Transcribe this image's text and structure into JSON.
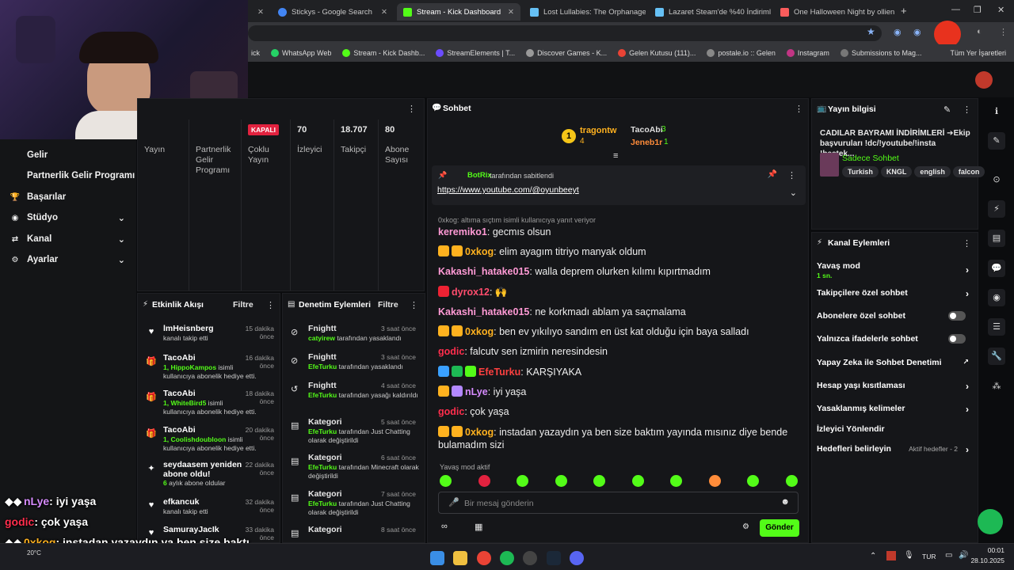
{
  "browser": {
    "tabs": [
      {
        "label": "Stickys - Google Search",
        "color": "#4285f4"
      },
      {
        "label": "Stream - Kick Dashboard",
        "color": "#53fc18"
      },
      {
        "label": "Lost Lullabies: The Orphanage",
        "color": "#66c0f4"
      },
      {
        "label": "Lazaret Steam'de %40 İndirimli",
        "color": "#66c0f4"
      },
      {
        "label": "One Halloween Night by ollien",
        "color": "#fa5c5c"
      }
    ],
    "bookmarks": [
      "WhatsApp Web",
      "Stream - Kick Dashb...",
      "StreamElements | T...",
      "Discover Games - K...",
      "Gelen Kutusu (111)...",
      "postale.io :: Gelen",
      "Instagram",
      "Submissions to Mag..."
    ],
    "bookmarks_all": "Tüm Yer İşaretleri",
    "bookmark_first": "ick"
  },
  "sidebar": {
    "items": [
      {
        "label": "Gelir",
        "icon": "money-icon",
        "glyph": "",
        "chev": ""
      },
      {
        "label": "Partnerlik Gelir Programı",
        "icon": "",
        "glyph": "",
        "chev": ""
      },
      {
        "label": "Başarılar",
        "icon": "trophy-icon",
        "glyph": "🏆",
        "chev": ""
      },
      {
        "label": "Stüdyo",
        "icon": "studio-icon",
        "glyph": "◉",
        "chev": "⌄"
      },
      {
        "label": "Kanal",
        "icon": "channel-icon",
        "glyph": "⇄",
        "chev": "⌄"
      },
      {
        "label": "Ayarlar",
        "icon": "settings-icon",
        "glyph": "⚙",
        "chev": "⌄"
      }
    ]
  },
  "stats": {
    "live_badge": "KAPALI",
    "cells": [
      {
        "value": "",
        "label": "Yayın"
      },
      {
        "value": "",
        "label": "Partnerlik Gelir Programı"
      },
      {
        "value": "",
        "label": "Çoklu Yayın"
      },
      {
        "value": "70",
        "label": "İzleyici"
      },
      {
        "value": "18.707",
        "label": "Takipçi"
      },
      {
        "value": "80",
        "label": "Abone Sayısı"
      }
    ]
  },
  "activity": {
    "title": "Etkinlik Akışı",
    "filter": "Filtre",
    "items": [
      {
        "icon": "heart-icon",
        "glyph": "♥",
        "name": "lmHeisnberg",
        "time": "15 dakika önce",
        "desc": "kanalı takip etti",
        "hl": ""
      },
      {
        "icon": "gift-icon",
        "glyph": "🎁",
        "name": "TacoAbi",
        "time": "16 dakika önce",
        "hl": "1, HippoKampos",
        "desc": " isimli kullanıcıya abonelik hediye etti."
      },
      {
        "icon": "gift-icon",
        "glyph": "🎁",
        "name": "TacoAbi",
        "time": "18 dakika önce",
        "hl": "1, WhiteBird5",
        "desc": " isimli kullanıcıya abonelik hediye etti."
      },
      {
        "icon": "gift-icon",
        "glyph": "🎁",
        "name": "TacoAbi",
        "time": "20 dakika önce",
        "hl": "1, Coolishdoubloon",
        "desc": " isimli kullanıcıya abonelik hediye etti."
      },
      {
        "icon": "star-icon",
        "glyph": "✦",
        "name": "seydaasem yeniden abone oldu!",
        "time": "22 dakika önce",
        "hl": "6",
        "desc": " aylık abone oldular"
      },
      {
        "icon": "heart-icon",
        "glyph": "♥",
        "name": "efkancuk",
        "time": "32 dakika önce",
        "desc": "kanalı takip etti",
        "hl": ""
      },
      {
        "icon": "heart-icon",
        "glyph": "♥",
        "name": "SamurayJacIk",
        "time": "33 dakika önce",
        "desc": "",
        "hl": ""
      }
    ]
  },
  "modlog": {
    "title": "Denetim Eylemleri",
    "filter": "Filtre",
    "items": [
      {
        "icon": "ban-icon",
        "glyph": "⊘",
        "name": "Fnightt",
        "time": "3 saat önce",
        "hl": "catyirew",
        "desc": " tarafından yasaklandı"
      },
      {
        "icon": "ban-icon",
        "glyph": "⊘",
        "name": "Fnightt",
        "time": "3 saat önce",
        "hl": "EfeTurku",
        "desc": " tarafından yasaklandı"
      },
      {
        "icon": "unban-icon",
        "glyph": "↺",
        "name": "Fnightt",
        "time": "4 saat önce",
        "hl": "EfeTurku",
        "desc": " tarafından yasağı kaldırıldı"
      },
      {
        "icon": "category-icon",
        "glyph": "▤",
        "name": "Kategori",
        "time": "5 saat önce",
        "hl": "EfeTurku",
        "desc": " tarafından Just Chatting olarak değiştirildi"
      },
      {
        "icon": "category-icon",
        "glyph": "▤",
        "name": "Kategori",
        "time": "6 saat önce",
        "hl": "EfeTurku",
        "desc": " tarafından Minecraft olarak değiştirildi"
      },
      {
        "icon": "category-icon",
        "glyph": "▤",
        "name": "Kategori",
        "time": "7 saat önce",
        "hl": "EfeTurku",
        "desc": " tarafından Just Chatting olarak değiştirildi"
      },
      {
        "icon": "category-icon",
        "glyph": "▤",
        "name": "Kategori",
        "time": "8 saat önce",
        "hl": "",
        "desc": ""
      }
    ]
  },
  "chat": {
    "title": "Sohbet",
    "top_gifters": [
      {
        "name": "tragontw",
        "count": "4"
      },
      {
        "name": "TacoAbi",
        "count": "3"
      },
      {
        "name": "Jeneb1r",
        "count": "1"
      }
    ],
    "pinned_by": "BotRix",
    "pinned_suffix": "tarafından sabitlendi",
    "pinned_link": "https://www.youtube.com/@oyunbeeyt",
    "reply_note": "0xkog: altıma sıçtım isimli kullanıcıya yanıt veriyor",
    "messages": [
      {
        "user": "keremiko1",
        "color": "#ff9ad5",
        "text": "gecmıs olsun",
        "badges": []
      },
      {
        "user": "0xkog",
        "color": "#ffb21f",
        "text": "elim ayagım titriyo manyak oldum",
        "badges": [
          "#ffb21f",
          "#ffb21f"
        ]
      },
      {
        "user": "Kakashi_hatake015",
        "color": "#ff9ad5",
        "text": "walla deprem olurken kılımı kıpırtmadım",
        "badges": []
      },
      {
        "user": "dyrox12",
        "color": "#ff4d6d",
        "text": "🙌",
        "badges": [
          "#e23"
        ]
      },
      {
        "user": "Kakashi_hatake015",
        "color": "#ff9ad5",
        "text": "ne korkmadı ablam ya saçmalama",
        "badges": []
      },
      {
        "user": "0xkog",
        "color": "#ffb21f",
        "text": "ben ev yıkılıyo sandım en üst kat olduğu için baya salladı",
        "badges": [
          "#ffb21f",
          "#ffb21f"
        ]
      },
      {
        "user": "godic",
        "color": "#ff2e4d",
        "text": "falcutv sen izmirin neresindesin",
        "badges": []
      },
      {
        "user": "EfeTurku",
        "color": "#ff4040",
        "text": "KARŞIYAKA",
        "badges": [
          "#3aa0ff",
          "#1db954",
          "#53fc18"
        ]
      },
      {
        "user": "nLye",
        "color": "#d78cff",
        "text": "iyi yaşa",
        "badges": [
          "#ffb21f",
          "#b388ff"
        ]
      },
      {
        "user": "godic",
        "color": "#ff2e4d",
        "text": "çok yaşa",
        "badges": []
      },
      {
        "user": "0xkog",
        "color": "#ffb21f",
        "text": "instadan yazaydın ya ben size baktım yayında mısınız diye bende bulamadım sizi",
        "badges": [
          "#ffb21f",
          "#ffb21f"
        ]
      }
    ],
    "slow_mode": "Yavaş mod aktif",
    "input_placeholder": "Bir mesaj gönderin",
    "send_label": "Gönder"
  },
  "stream_info": {
    "title": "Yayın bilgisi",
    "stream_title": "CADILAR BAYRAMI İNDİRİMLERİ ➔Ekip başvuruları !dc/!youtube/!insta !beetek...",
    "category": "Sadece Sohbet",
    "tags": [
      "Turkish",
      "KNGL",
      "english",
      "falcon"
    ]
  },
  "channel_actions": {
    "title": "Kanal Eylemleri",
    "items": [
      {
        "label": "Yavaş mod",
        "sub": "1 sn.",
        "control": "chevron"
      },
      {
        "label": "Takipçilere özel sohbet",
        "sub": "",
        "control": "chevron"
      },
      {
        "label": "Abonelere özel sohbet",
        "sub": "",
        "control": "toggle"
      },
      {
        "label": "Yalnızca ifadelerle sohbet",
        "sub": "",
        "control": "toggle"
      },
      {
        "label": "Yapay Zeka ile Sohbet Denetimi",
        "sub": "",
        "control": "external"
      },
      {
        "label": "Hesap yaşı kısıtlaması",
        "sub": "",
        "control": "chevron"
      },
      {
        "label": "Yasaklanmış kelimeler",
        "sub": "",
        "control": "chevron"
      },
      {
        "label": "İzleyici Yönlendir",
        "sub": "",
        "control": "none"
      },
      {
        "label": "Hedefleri belirleyin",
        "sub": "",
        "control": "chevron",
        "status": "Aktif hedefler - 2"
      }
    ]
  },
  "overlay_chat": [
    {
      "user": "nLye",
      "color": "#d78cff",
      "text": ": iyi yaşa"
    },
    {
      "user": "godic",
      "color": "#ff2e4d",
      "text": ": çok yaşa"
    },
    {
      "user": "0xkog",
      "color": "#ffb21f",
      "text": ": instadan yazaydın ya ben size baktı"
    },
    {
      "user": "",
      "color": "#fff",
      "text": "bulamadım sizi"
    }
  ],
  "taskbar": {
    "weather": "20°C",
    "lang": "TUR",
    "time": "00:01",
    "date": "28.10.2025"
  }
}
